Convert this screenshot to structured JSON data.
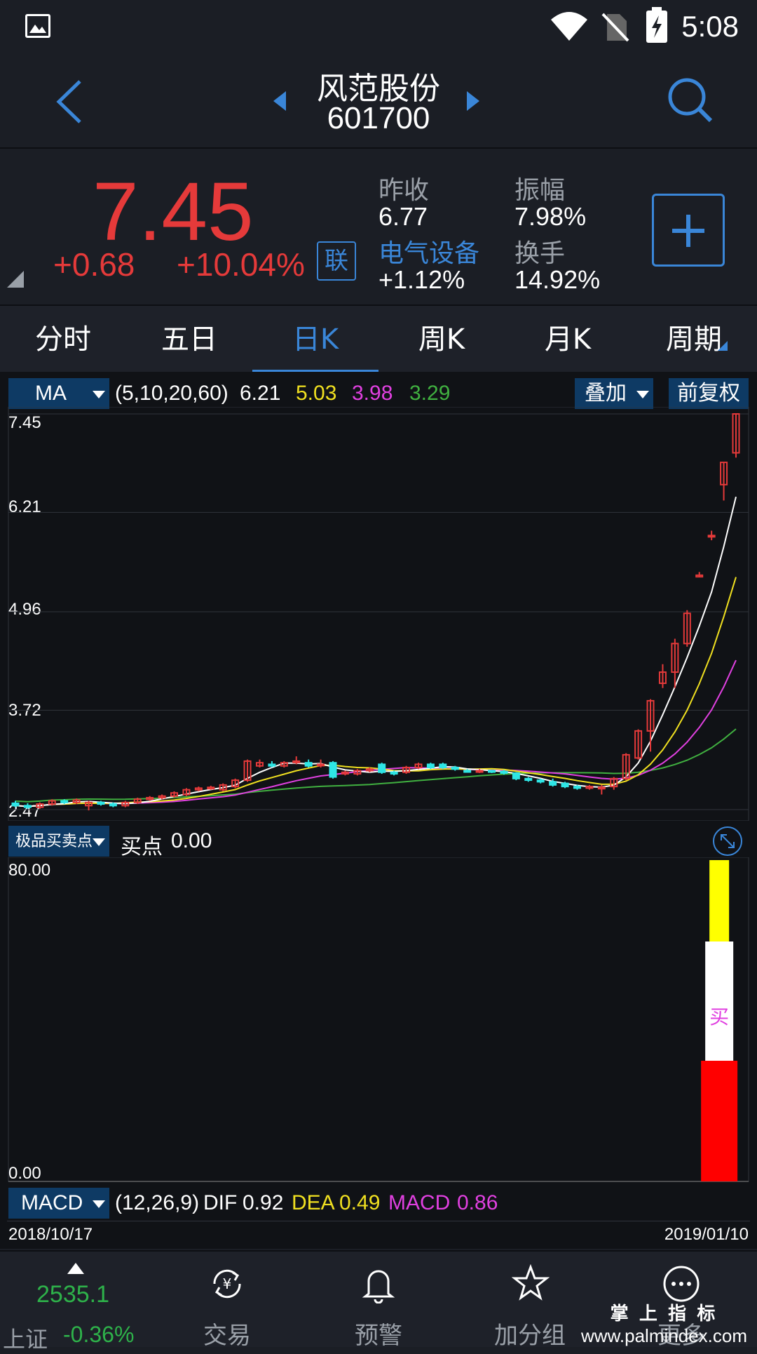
{
  "status_bar": {
    "time": "5:08"
  },
  "header": {
    "stock_name": "风范股份",
    "stock_code": "601700"
  },
  "quote": {
    "price": "7.45",
    "change": "+0.68",
    "change_pct": "+10.04%",
    "link_label": "联",
    "prev_close_label": "昨收",
    "prev_close": "6.77",
    "amplitude_label": "振幅",
    "amplitude": "7.98%",
    "sector_label": "电气设备",
    "sector_change": "+1.12%",
    "turnover_label": "换手",
    "turnover": "14.92%"
  },
  "tabs": [
    "分时",
    "五日",
    "日K",
    "周K",
    "月K",
    "周期"
  ],
  "active_tab": "日K",
  "ma_legend": {
    "indicator": "MA",
    "params": "(5,10,20,60)",
    "ma5": "6.21",
    "ma10": "5.03",
    "ma20": "3.98",
    "ma60": "3.29",
    "overlay": "叠加",
    "adjust": "前复权"
  },
  "price_axis": [
    "7.45",
    "6.21",
    "4.96",
    "3.72",
    "2.47"
  ],
  "signal_legend": {
    "indicator": "极品买卖点",
    "label": "买点",
    "value": "0.00"
  },
  "signal_axis": [
    "80.00",
    "0.00"
  ],
  "signal_mark": "买",
  "macd_legend": {
    "indicator": "MACD",
    "params": "(12,26,9)",
    "dif_label": "DIF",
    "dif": "0.92",
    "dea_label": "DEA",
    "dea": "0.49",
    "macd_label": "MACD",
    "macd": "0.86"
  },
  "dates": {
    "start": "2018/10/17",
    "end": "2019/01/10"
  },
  "bottom_nav": {
    "index_value": "2535.1",
    "index_name": "上证",
    "index_pct": "-0.36%",
    "items": [
      "交易",
      "预警",
      "加分组",
      "更多"
    ]
  },
  "watermark": {
    "line1": "掌 上 指 标",
    "line2": "www.palmindex.com"
  },
  "colors": {
    "up": "#e53a3a",
    "down": "#2ee6e6",
    "accent": "#3a86d8",
    "ma5": "#ffffff",
    "ma10": "#f0e020",
    "ma20": "#e040e0",
    "ma60": "#40b040"
  },
  "chart_data": {
    "type": "candlestick",
    "ylim": [
      2.47,
      7.45
    ],
    "candles": [
      {
        "o": 2.55,
        "c": 2.52,
        "h": 2.58,
        "l": 2.5
      },
      {
        "o": 2.52,
        "c": 2.5,
        "h": 2.55,
        "l": 2.48
      },
      {
        "o": 2.5,
        "c": 2.54,
        "h": 2.56,
        "l": 2.48
      },
      {
        "o": 2.54,
        "c": 2.58,
        "h": 2.6,
        "l": 2.52
      },
      {
        "o": 2.58,
        "c": 2.56,
        "h": 2.6,
        "l": 2.54
      },
      {
        "o": 2.56,
        "c": 2.59,
        "h": 2.61,
        "l": 2.54
      },
      {
        "o": 2.52,
        "c": 2.56,
        "h": 2.58,
        "l": 2.46
      },
      {
        "o": 2.56,
        "c": 2.54,
        "h": 2.58,
        "l": 2.52
      },
      {
        "o": 2.54,
        "c": 2.52,
        "h": 2.56,
        "l": 2.5
      },
      {
        "o": 2.52,
        "c": 2.56,
        "h": 2.58,
        "l": 2.5
      },
      {
        "o": 2.56,
        "c": 2.6,
        "h": 2.62,
        "l": 2.54
      },
      {
        "o": 2.6,
        "c": 2.62,
        "h": 2.64,
        "l": 2.58
      },
      {
        "o": 2.62,
        "c": 2.64,
        "h": 2.66,
        "l": 2.6
      },
      {
        "o": 2.64,
        "c": 2.68,
        "h": 2.7,
        "l": 2.62
      },
      {
        "o": 2.66,
        "c": 2.72,
        "h": 2.74,
        "l": 2.64
      },
      {
        "o": 2.72,
        "c": 2.74,
        "h": 2.76,
        "l": 2.7
      },
      {
        "o": 2.74,
        "c": 2.75,
        "h": 2.77,
        "l": 2.72
      },
      {
        "o": 2.72,
        "c": 2.78,
        "h": 2.8,
        "l": 2.7
      },
      {
        "o": 2.76,
        "c": 2.84,
        "h": 2.86,
        "l": 2.74
      },
      {
        "o": 2.84,
        "c": 3.08,
        "h": 3.1,
        "l": 2.82
      },
      {
        "o": 3.02,
        "c": 3.06,
        "h": 3.1,
        "l": 3.0
      },
      {
        "o": 3.04,
        "c": 3.02,
        "h": 3.08,
        "l": 3.0
      },
      {
        "o": 3.02,
        "c": 3.06,
        "h": 3.08,
        "l": 3.0
      },
      {
        "o": 3.08,
        "c": 3.08,
        "h": 3.14,
        "l": 3.04
      },
      {
        "o": 3.06,
        "c": 3.02,
        "h": 3.1,
        "l": 3.0
      },
      {
        "o": 3.04,
        "c": 3.04,
        "h": 3.1,
        "l": 3.0
      },
      {
        "o": 3.06,
        "c": 2.88,
        "h": 3.08,
        "l": 2.86
      },
      {
        "o": 2.92,
        "c": 2.94,
        "h": 2.96,
        "l": 2.9
      },
      {
        "o": 2.92,
        "c": 2.96,
        "h": 2.98,
        "l": 2.9
      },
      {
        "o": 2.96,
        "c": 2.98,
        "h": 3.0,
        "l": 2.94
      },
      {
        "o": 3.04,
        "c": 2.94,
        "h": 3.06,
        "l": 2.92
      },
      {
        "o": 2.94,
        "c": 2.92,
        "h": 2.96,
        "l": 2.9
      },
      {
        "o": 2.94,
        "c": 3.0,
        "h": 3.02,
        "l": 2.92
      },
      {
        "o": 3.0,
        "c": 3.04,
        "h": 3.06,
        "l": 2.98
      },
      {
        "o": 3.04,
        "c": 3.0,
        "h": 3.06,
        "l": 2.98
      },
      {
        "o": 3.04,
        "c": 3.0,
        "h": 3.06,
        "l": 2.98
      },
      {
        "o": 3.0,
        "c": 2.98,
        "h": 3.02,
        "l": 2.96
      },
      {
        "o": 2.96,
        "c": 2.95,
        "h": 2.98,
        "l": 2.94
      },
      {
        "o": 2.95,
        "c": 2.96,
        "h": 2.98,
        "l": 2.93
      },
      {
        "o": 2.96,
        "c": 2.95,
        "h": 2.97,
        "l": 2.93
      },
      {
        "o": 2.95,
        "c": 2.93,
        "h": 2.97,
        "l": 2.91
      },
      {
        "o": 2.93,
        "c": 2.86,
        "h": 2.94,
        "l": 2.84
      },
      {
        "o": 2.86,
        "c": 2.84,
        "h": 2.88,
        "l": 2.82
      },
      {
        "o": 2.84,
        "c": 2.82,
        "h": 2.86,
        "l": 2.8
      },
      {
        "o": 2.82,
        "c": 2.78,
        "h": 2.86,
        "l": 2.76
      },
      {
        "o": 2.8,
        "c": 2.76,
        "h": 2.82,
        "l": 2.74
      },
      {
        "o": 2.76,
        "c": 2.74,
        "h": 2.78,
        "l": 2.72
      },
      {
        "o": 2.74,
        "c": 2.76,
        "h": 2.78,
        "l": 2.72
      },
      {
        "o": 2.74,
        "c": 2.75,
        "h": 2.78,
        "l": 2.66
      },
      {
        "o": 2.76,
        "c": 2.86,
        "h": 2.88,
        "l": 2.72
      },
      {
        "o": 2.86,
        "c": 3.16,
        "h": 3.18,
        "l": 2.84
      },
      {
        "o": 3.12,
        "c": 3.46,
        "h": 3.48,
        "l": 3.1
      },
      {
        "o": 3.46,
        "c": 3.84,
        "h": 3.86,
        "l": 3.2
      },
      {
        "o": 4.06,
        "c": 4.2,
        "h": 4.3,
        "l": 4.0
      },
      {
        "o": 4.2,
        "c": 4.56,
        "h": 4.62,
        "l": 4.0
      },
      {
        "o": 4.56,
        "c": 4.94,
        "h": 4.98,
        "l": 4.52
      },
      {
        "o": 5.4,
        "c": 5.42,
        "h": 5.46,
        "l": 5.4
      },
      {
        "o": 5.92,
        "c": 5.92,
        "h": 5.98,
        "l": 5.86
      },
      {
        "o": 6.56,
        "c": 6.84,
        "h": 6.84,
        "l": 6.36
      },
      {
        "o": 6.96,
        "c": 7.45,
        "h": 7.45,
        "l": 6.9
      }
    ],
    "ma_latest": {
      "MA5": 6.21,
      "MA10": 5.03,
      "MA20": 3.98,
      "MA60": 3.29
    },
    "signal": {
      "ylim": [
        0,
        80
      ],
      "buy_index": 57
    }
  }
}
